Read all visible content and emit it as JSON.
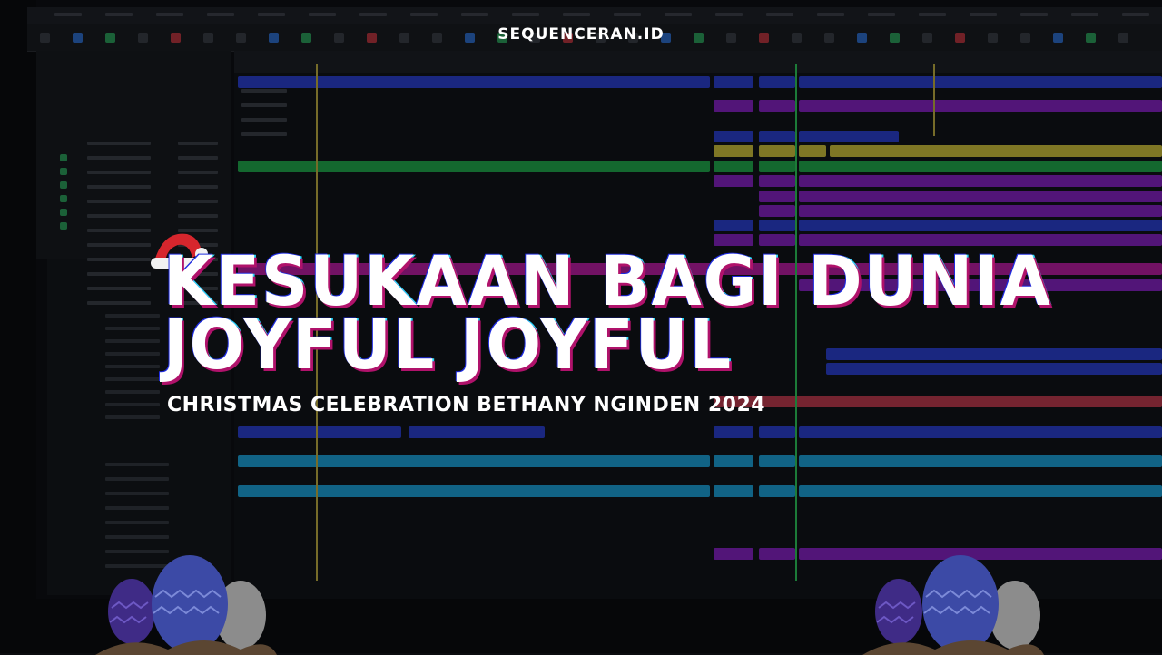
{
  "brand": {
    "text": "SEQUENCERAN.ID"
  },
  "title": {
    "line1": "KESUKAAN BAGI DUNIA",
    "line2": "JOYFUL JOYFUL"
  },
  "subtitle": "CHRISTMAS CELEBRATION BETHANY NGINDEN 2024",
  "decorations": {
    "hat_icon": "santa-hat-icon",
    "eggs_icon": "easter-eggs-icon"
  },
  "colors": {
    "blue": "#2a3fd6",
    "purple": "#8a1fc9",
    "magenta": "#c21aa6",
    "green": "#1fae4a",
    "yellow": "#d7c93a",
    "cyan": "#1aa6de",
    "red": "#c63a4d",
    "playhead_yellow": "#c9b640",
    "playhead_green": "#2ecf5a",
    "title_shadow": "#b0126b"
  }
}
